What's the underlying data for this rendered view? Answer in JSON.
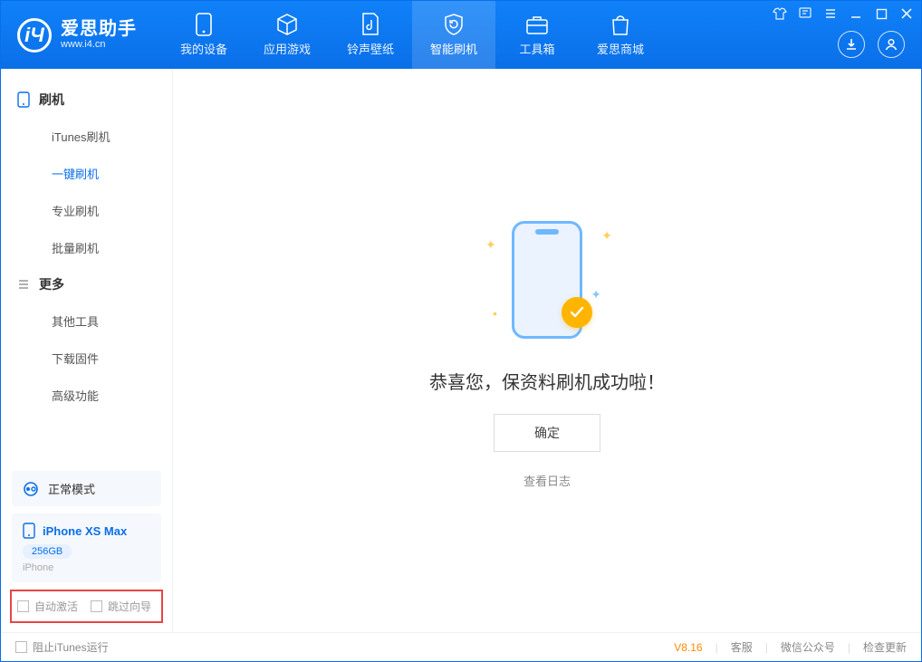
{
  "app": {
    "title": "爱思助手",
    "subtitle": "www.i4.cn"
  },
  "tabs": [
    {
      "label": "我的设备",
      "icon": "device"
    },
    {
      "label": "应用游戏",
      "icon": "cube"
    },
    {
      "label": "铃声壁纸",
      "icon": "music"
    },
    {
      "label": "智能刷机",
      "icon": "shield",
      "active": true
    },
    {
      "label": "工具箱",
      "icon": "toolbox"
    },
    {
      "label": "爱思商城",
      "icon": "bag"
    }
  ],
  "sidebar": {
    "group1": {
      "title": "刷机"
    },
    "items1": [
      {
        "label": "iTunes刷机"
      },
      {
        "label": "一键刷机",
        "active": true
      },
      {
        "label": "专业刷机"
      },
      {
        "label": "批量刷机"
      }
    ],
    "group2": {
      "title": "更多"
    },
    "items2": [
      {
        "label": "其他工具"
      },
      {
        "label": "下载固件"
      },
      {
        "label": "高级功能"
      }
    ],
    "mode": {
      "label": "正常模式"
    },
    "device": {
      "name": "iPhone XS Max",
      "capacity": "256GB",
      "type": "iPhone"
    },
    "checks": {
      "auto_activate": "自动激活",
      "skip_guide": "跳过向导"
    }
  },
  "main": {
    "success": "恭喜您，保资料刷机成功啦！",
    "ok": "确定",
    "log": "查看日志"
  },
  "footer": {
    "block_itunes": "阻止iTunes运行",
    "version": "V8.16",
    "links": {
      "service": "客服",
      "wechat": "微信公众号",
      "update": "检查更新"
    }
  }
}
